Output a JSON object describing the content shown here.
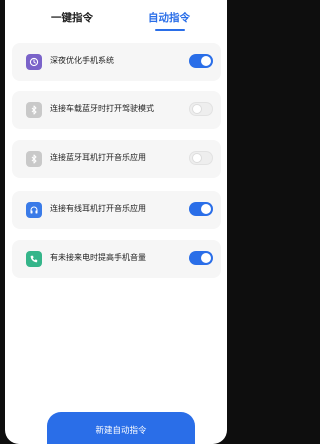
{
  "tabs": [
    {
      "label": "一键指令",
      "active": false
    },
    {
      "label": "自动指令",
      "active": true
    }
  ],
  "items": [
    {
      "label": "深夜优化手机系统",
      "icon": "moon-clock-icon",
      "icon_color": "#7a63c9",
      "enabled": true
    },
    {
      "label": "连接车载蓝牙时打开驾驶模式",
      "icon": "bluetooth-icon",
      "icon_color": "#c9c9c9",
      "enabled": false
    },
    {
      "label": "连接蓝牙耳机打开音乐应用",
      "icon": "bluetooth-icon",
      "icon_color": "#c9c9c9",
      "enabled": false
    },
    {
      "label": "连接有线耳机打开音乐应用",
      "icon": "headphones-icon",
      "icon_color": "#3a7be8",
      "enabled": true
    },
    {
      "label": "有未接来电时提高手机音量",
      "icon": "phone-icon",
      "icon_color": "#35b58a",
      "enabled": true
    }
  ],
  "new_button_label": "新建自动指令",
  "colors": {
    "accent": "#2a6ee8"
  }
}
